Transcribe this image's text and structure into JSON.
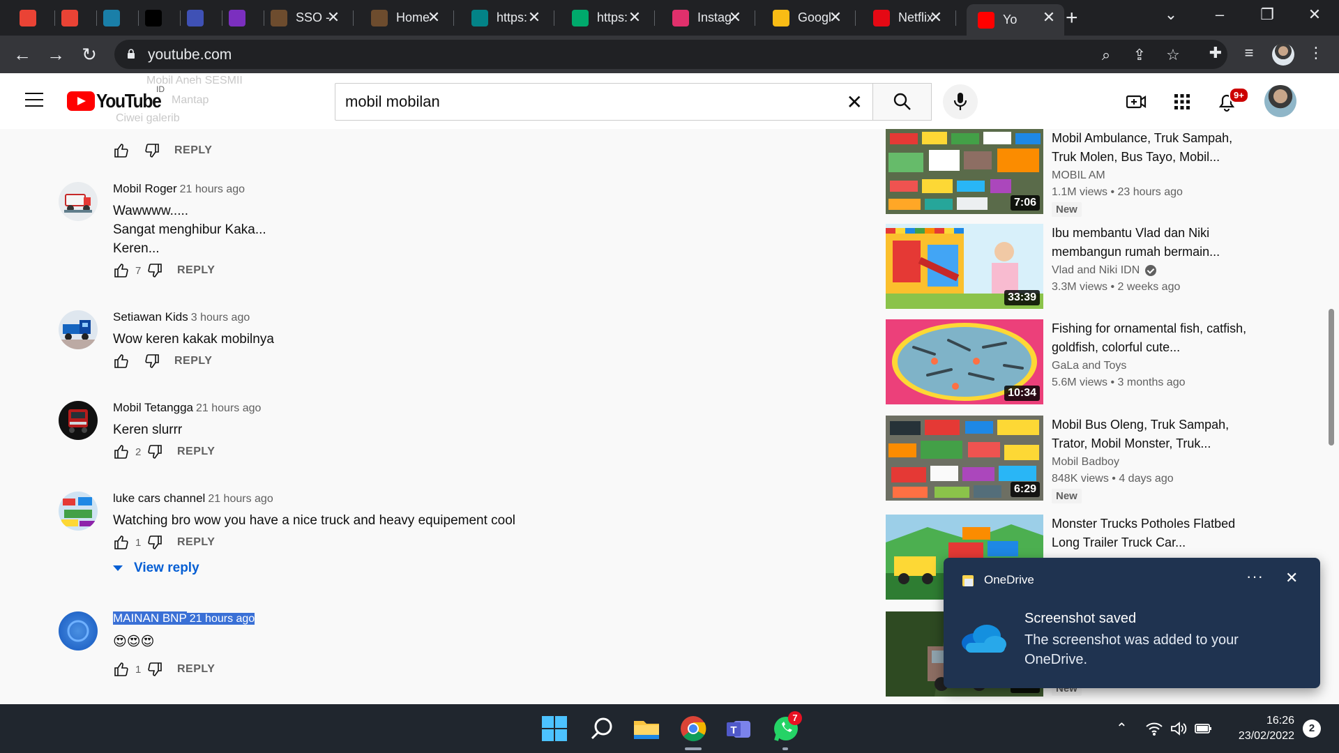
{
  "browser": {
    "tabs": [
      {
        "label": "",
        "icon": "gmail-icon",
        "color": "#EA4335"
      },
      {
        "label": "",
        "icon": "gmail-icon",
        "color": "#EA4335"
      },
      {
        "label": "",
        "icon": "app-icon",
        "color": "#1a7fa8"
      },
      {
        "label": "",
        "icon": "genius-icon",
        "color": "#000000"
      },
      {
        "label": "",
        "icon": "dp-icon",
        "color": "#3f51b5"
      },
      {
        "label": "",
        "icon": "u-icon",
        "color": "#7b2fbf"
      },
      {
        "label": "SSO -",
        "icon": "university-icon",
        "color": "#6d4c2e"
      },
      {
        "label": "Home",
        "icon": "university-icon",
        "color": "#6d4c2e"
      },
      {
        "label": "https:",
        "icon": "sharepoint-icon",
        "color": "#038387"
      },
      {
        "label": "https:",
        "icon": "tripadvisor-icon",
        "color": "#00aa6c"
      },
      {
        "label": "Instag",
        "icon": "instagram-icon",
        "color": "#e1306c"
      },
      {
        "label": "Googl",
        "icon": "keep-icon",
        "color": "#f9bc15"
      },
      {
        "label": "Netflix",
        "icon": "netflix-icon",
        "color": "#e50914"
      },
      {
        "label": "Yo",
        "icon": "youtube-icon",
        "color": "#ff0000"
      }
    ],
    "url": "youtube.com"
  },
  "youtube": {
    "country_code": "ID",
    "search_query": "mobil mobilan",
    "notifications_badge": "9+",
    "ghost_lines": [
      "Mobil Aneh SESMII",
      "Mantap",
      "Ciwei galerib"
    ]
  },
  "comments": [
    {
      "author": "",
      "time": "",
      "text": "",
      "likes": "",
      "reply": "REPLY",
      "avatar": "hidden"
    },
    {
      "author": "Mobil Roger",
      "time": "21 hours ago",
      "text": "Wawwww.....\nSangat menghibur Kaka...\nKeren...",
      "likes": "7",
      "reply": "REPLY",
      "avatar": "truck-white"
    },
    {
      "author": "Setiawan Kids",
      "time": "3 hours ago",
      "text": "Wow keren kakak mobilnya",
      "likes": "",
      "reply": "REPLY",
      "avatar": "truck-blue"
    },
    {
      "author": "Mobil Tetangga",
      "time": "21 hours ago",
      "text": "Keren slurrr",
      "likes": "2",
      "reply": "REPLY",
      "avatar": "truck-red"
    },
    {
      "author": "luke cars channel",
      "time": "21 hours ago",
      "text": "Watching bro wow you have a nice truck and heavy equipement cool",
      "likes": "1",
      "reply": "REPLY",
      "avatar": "toy-cars",
      "view_reply": "View reply"
    },
    {
      "author": "MAINAN BNP",
      "time": "21 hours ago",
      "text": "😍😍😍",
      "likes": "1",
      "reply": "REPLY",
      "avatar": "blue-circle"
    }
  ],
  "recommendations": [
    {
      "title": "Mobil Ambulance, Truk Sampah, Truk Molen, Bus Tayo, Mobil...",
      "channel": "MOBIL AM",
      "views": "1.1M views",
      "age": "23 hours ago",
      "duration": "7:06",
      "badge": "New",
      "verified": false
    },
    {
      "title": "Ibu membantu Vlad dan Niki membangun rumah bermain...",
      "channel": "Vlad and Niki IDN",
      "views": "3.3M views",
      "age": "2 weeks ago",
      "duration": "33:39",
      "badge": "",
      "verified": true
    },
    {
      "title": "Fishing for ornamental fish, catfish, goldfish, colorful cute...",
      "channel": "GaLa and Toys",
      "views": "5.6M views",
      "age": "3 months ago",
      "duration": "10:34",
      "badge": "",
      "verified": false
    },
    {
      "title": "Mobil Bus Oleng, Truk Sampah, Trator, Mobil Monster, Truk...",
      "channel": "Mobil Badboy",
      "views": "848K views",
      "age": "4 days ago",
      "duration": "6:29",
      "badge": "New",
      "verified": false
    },
    {
      "title": "Monster Trucks Potholes Flatbed Long Trailer Truck Car...",
      "channel": "",
      "views": "",
      "age": "",
      "duration": "",
      "badge": "",
      "verified": false
    },
    {
      "title": "",
      "channel": "",
      "views": "",
      "age": "",
      "duration": "5:55",
      "badge": "New",
      "verified": false
    }
  ],
  "toast": {
    "app": "OneDrive",
    "more": "···",
    "title": "Screenshot saved",
    "body": "The screenshot was added to your OneDrive."
  },
  "taskbar": {
    "whatsapp_badge": "7",
    "time": "16:26",
    "date": "23/02/2022",
    "notification_count": "2"
  },
  "colors": {
    "accent": "#ff0000",
    "link": "#065fd4",
    "selection": "#3a70d6",
    "toast_bg": "#1f3350",
    "taskbar_bg": "#20262e"
  }
}
